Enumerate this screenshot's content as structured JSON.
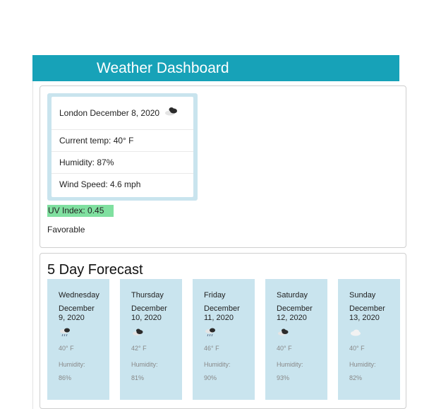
{
  "header": {
    "title": "Weather Dashboard"
  },
  "current": {
    "city_date": "London December 8, 2020",
    "icon": "cloudy-icon",
    "temp": "Current temp: 40° F",
    "humidity": "Humidity: 87%",
    "wind": "Wind Speed: 4.6 mph",
    "uv_index": "UV Index: 0.45",
    "uv_status": "Favorable",
    "uv_color": "#80e0a0"
  },
  "forecast": {
    "title": "5 Day Forecast",
    "days": [
      {
        "day": "Wednesday",
        "date": "December 9, 2020",
        "icon": "rain-icon",
        "temp": "40° F",
        "humidity_label": "Humidity:",
        "humidity": "86%"
      },
      {
        "day": "Thursday",
        "date": "December 10, 2020",
        "icon": "cloudy-icon",
        "temp": "42° F",
        "humidity_label": "Humidity:",
        "humidity": "81%"
      },
      {
        "day": "Friday",
        "date": "December 11, 2020",
        "icon": "rain-icon",
        "temp": "46° F",
        "humidity_label": "Humidity:",
        "humidity": "90%"
      },
      {
        "day": "Saturday",
        "date": "December 12, 2020",
        "icon": "cloudy-icon",
        "temp": "40° F",
        "humidity_label": "Humidity:",
        "humidity": "93%"
      },
      {
        "day": "Sunday",
        "date": "December 13, 2020",
        "icon": "cloud-icon",
        "temp": "40° F",
        "humidity_label": "Humidity:",
        "humidity": "82%"
      }
    ]
  },
  "colors": {
    "accent": "#17a2b8",
    "card": "#c9e4ee"
  }
}
